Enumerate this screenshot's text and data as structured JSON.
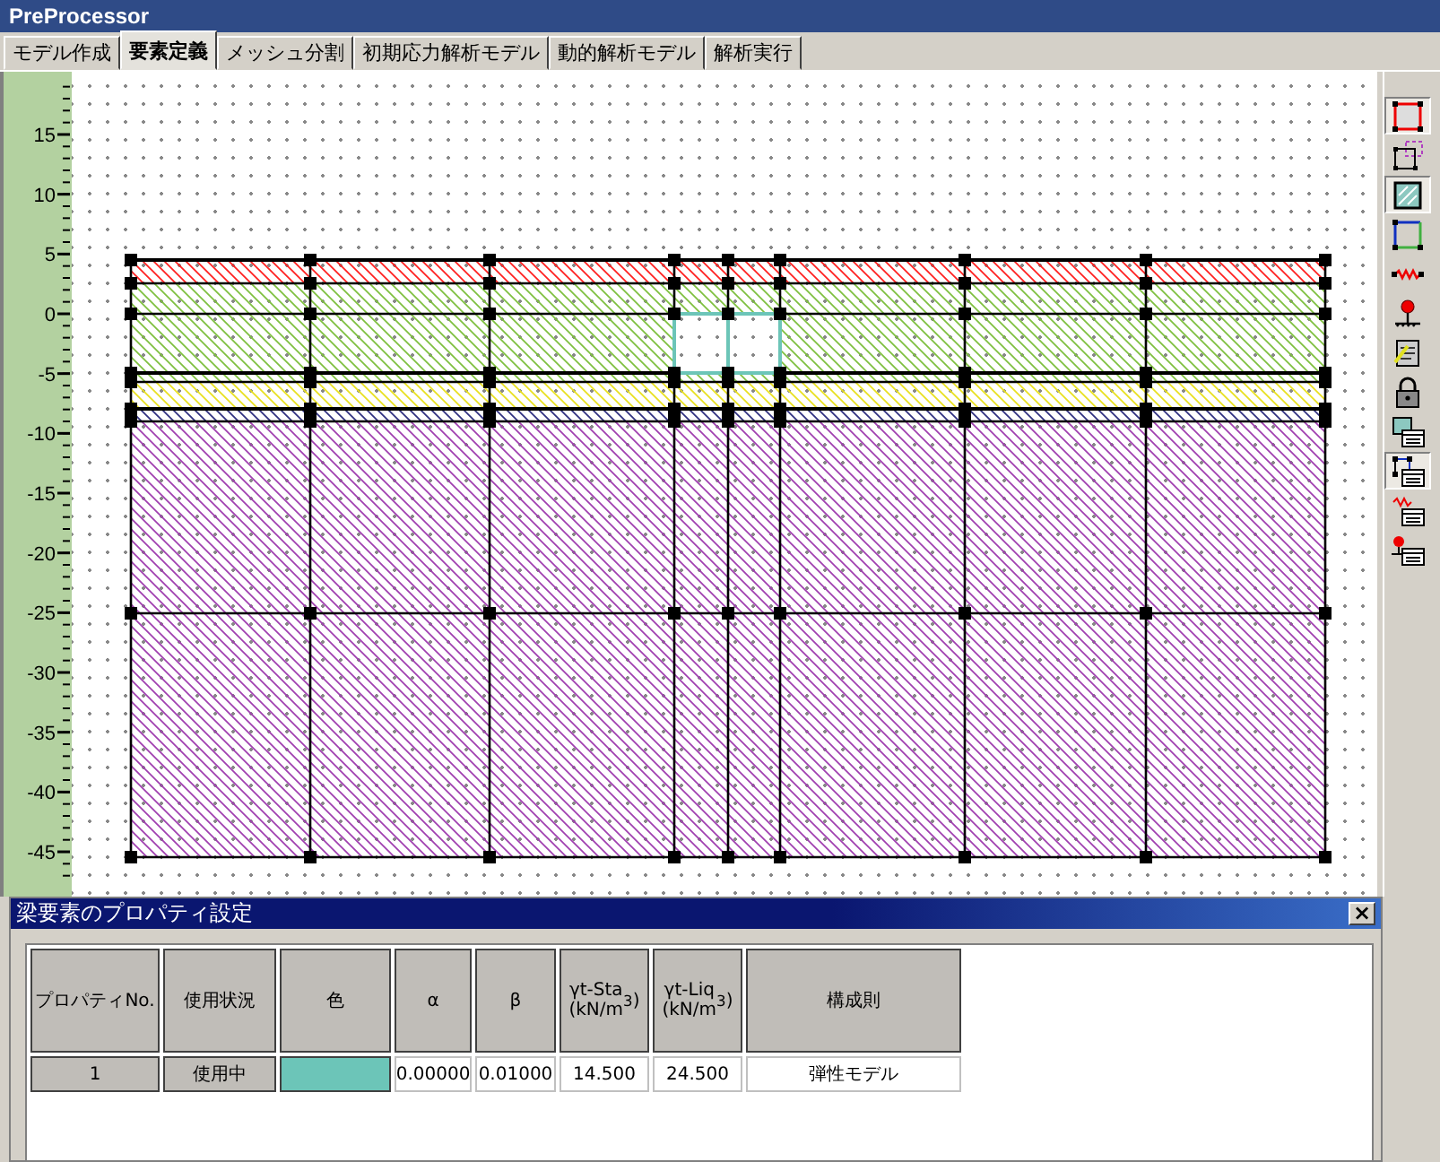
{
  "window": {
    "title": "PreProcessor"
  },
  "tabs": [
    {
      "label": "モデル作成",
      "selected": false
    },
    {
      "label": "要素定義",
      "selected": true
    },
    {
      "label": "メッシュ分割",
      "selected": false
    },
    {
      "label": "初期応力解析モデル",
      "selected": false
    },
    {
      "label": "動的解析モデル",
      "selected": false
    },
    {
      "label": "解析実行",
      "selected": false
    }
  ],
  "ruler": {
    "labels": [
      "15",
      "10",
      "5",
      "0",
      "-5",
      "-10",
      "-15",
      "-20",
      "-25",
      "-30",
      "-35",
      "-40",
      "-45"
    ]
  },
  "toolbar": [
    {
      "kind": "node-square",
      "selected": true
    },
    {
      "kind": "dashed-square",
      "selected": false
    },
    {
      "kind": "filled-square",
      "selected": true
    },
    {
      "kind": "edge-square",
      "selected": false
    },
    {
      "kind": "zigzag",
      "selected": false
    },
    {
      "kind": "pin",
      "selected": false
    },
    {
      "kind": "document",
      "selected": false
    },
    {
      "kind": "padlock",
      "selected": false
    },
    {
      "kind": "square-table",
      "selected": false
    },
    {
      "kind": "frame-table",
      "selected": true
    },
    {
      "kind": "zigzag-table",
      "selected": false
    },
    {
      "kind": "pin-table",
      "selected": false
    }
  ],
  "dialog": {
    "title": "梁要素のプロパティ設定",
    "close": "×",
    "table": {
      "columns": [
        {
          "label": "プロパティNo."
        },
        {
          "label": "使用状況"
        },
        {
          "label": "色"
        },
        {
          "label": "α"
        },
        {
          "label": "β"
        },
        {
          "label": "γt-Sta",
          "unit": "(kN/m$^{3}$)"
        },
        {
          "label": "γt-Liq",
          "unit": "(kN/m$^{3}$)"
        },
        {
          "label": "構成則"
        }
      ],
      "rows": [
        {
          "no": "1",
          "status": "使用中",
          "color": "#6cc5b8",
          "alpha": "0.00000",
          "beta": "0.01000",
          "gt_sta": "14.500",
          "gt_liq": "24.500",
          "model": "弾性モデル"
        }
      ]
    }
  }
}
